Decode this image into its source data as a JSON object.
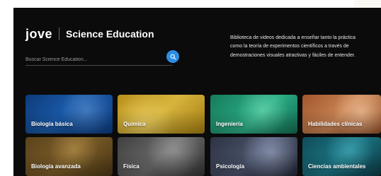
{
  "brand": {
    "logo": "jove",
    "product_title": "Science Education"
  },
  "search": {
    "placeholder": "Buscar Science Education..."
  },
  "description": {
    "lines": [
      "Biblioteca de videos dedicada a enseñar tanto la práctica",
      "como la teoría de experimentos científicos a través de",
      "demostraciones visuales atractivas y fáciles de entender."
    ]
  },
  "tiles": [
    {
      "label": "Biología básica",
      "color": "#1a5aa8"
    },
    {
      "label": "Química",
      "color": "#d7b43c"
    },
    {
      "label": "Ingeniería",
      "color": "#2cae86"
    },
    {
      "label": "Habilidades clínicas",
      "color": "#c98454"
    },
    {
      "label": "Biología avanzada",
      "color": "#7b5c28"
    },
    {
      "label": "Física",
      "color": "#6a6a6a"
    },
    {
      "label": "Psicología",
      "color": "#4b546c"
    },
    {
      "label": "Ciencias ambientales",
      "color": "#1c7584"
    }
  ],
  "icons": {
    "search_button": "search-icon"
  },
  "colors": {
    "panel_background": "#0b0b0b",
    "accent": "#2a8ee6"
  }
}
